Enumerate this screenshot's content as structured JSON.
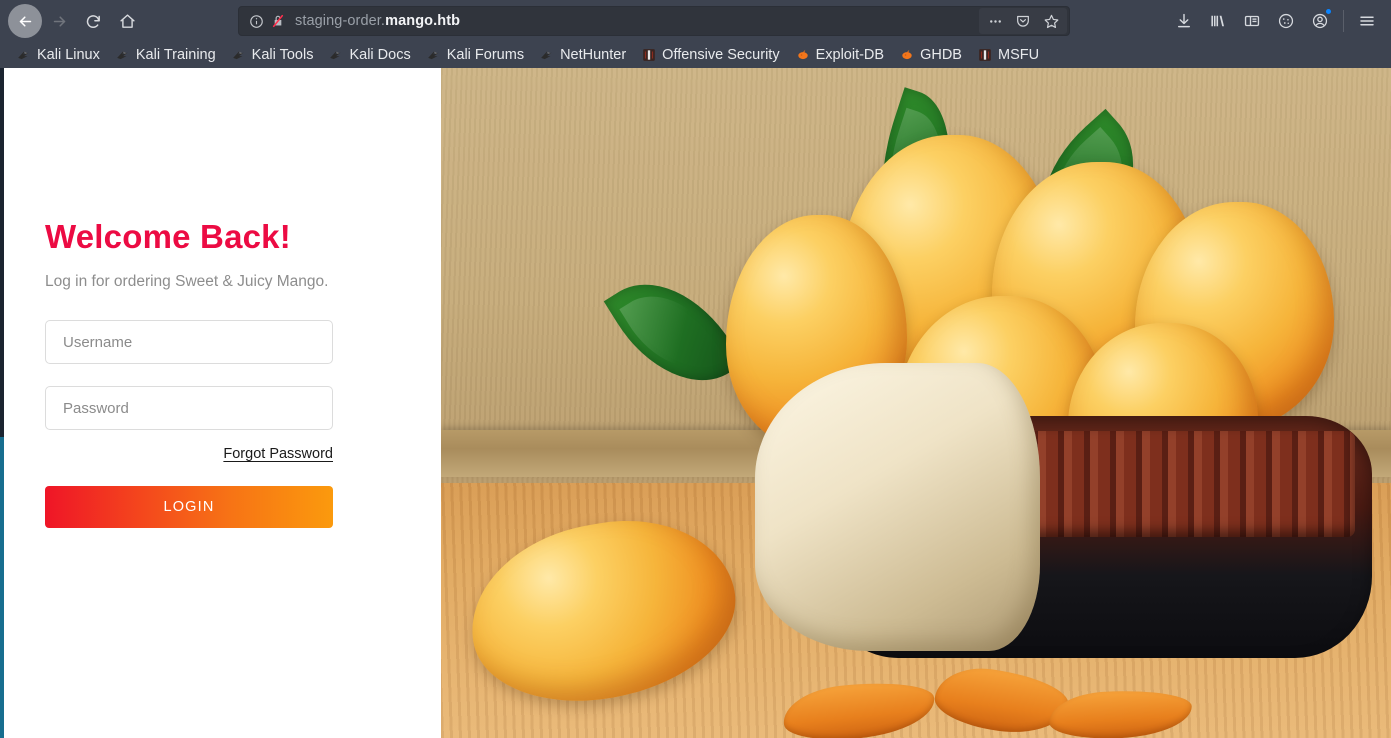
{
  "browser": {
    "nav": {
      "back_icon": "back-arrow-icon",
      "forward_icon": "forward-arrow-icon",
      "reload_icon": "reload-icon",
      "home_icon": "home-icon"
    },
    "urlbar": {
      "identity_icon": "info-circle-icon",
      "security_icon": "broken-lock-icon",
      "url_prefix": "staging-order.",
      "url_domain": "mango.htb",
      "full_url": "staging-order.mango.htb",
      "page_actions_icon": "ellipsis-icon",
      "pocket_icon": "pocket-icon",
      "bookmark_star_icon": "star-icon"
    },
    "toolbar_right": [
      {
        "name": "downloads-icon",
        "glyph": "download"
      },
      {
        "name": "library-icon",
        "glyph": "library"
      },
      {
        "name": "sidebar-icon",
        "glyph": "sidebar"
      },
      {
        "name": "containers-icon",
        "glyph": "cookie"
      },
      {
        "name": "account-icon",
        "glyph": "account",
        "badge": true
      },
      {
        "name": "app-menu-icon",
        "glyph": "hamburger"
      }
    ],
    "bookmarks": [
      {
        "label": "Kali Linux",
        "icon": "kali-dragon-icon"
      },
      {
        "label": "Kali Training",
        "icon": "kali-dragon-icon"
      },
      {
        "label": "Kali Tools",
        "icon": "kali-dragon-icon"
      },
      {
        "label": "Kali Docs",
        "icon": "kali-dragon-icon"
      },
      {
        "label": "Kali Forums",
        "icon": "kali-dragon-icon"
      },
      {
        "label": "NetHunter",
        "icon": "kali-dragon-icon"
      },
      {
        "label": "Offensive Security",
        "icon": "offsec-icon"
      },
      {
        "label": "Exploit-DB",
        "icon": "exploitdb-icon"
      },
      {
        "label": "GHDB",
        "icon": "exploitdb-icon"
      },
      {
        "label": "MSFU",
        "icon": "offsec-icon"
      }
    ]
  },
  "login": {
    "title": "Welcome Back!",
    "subtitle": "Log in for ordering Sweet & Juicy Mango.",
    "username_placeholder": "Username",
    "username_value": "",
    "password_placeholder": "Password",
    "password_value": "",
    "forgot_label": "Forgot Password",
    "submit_label": "LOGIN",
    "accent_start": "#ef1527",
    "accent_end": "#fb9a0d",
    "title_color": "#ec0b43"
  },
  "hero": {
    "alt": "Ripe yellow mangoes with green leaves in a dark ceramic basket on a wooden table"
  }
}
